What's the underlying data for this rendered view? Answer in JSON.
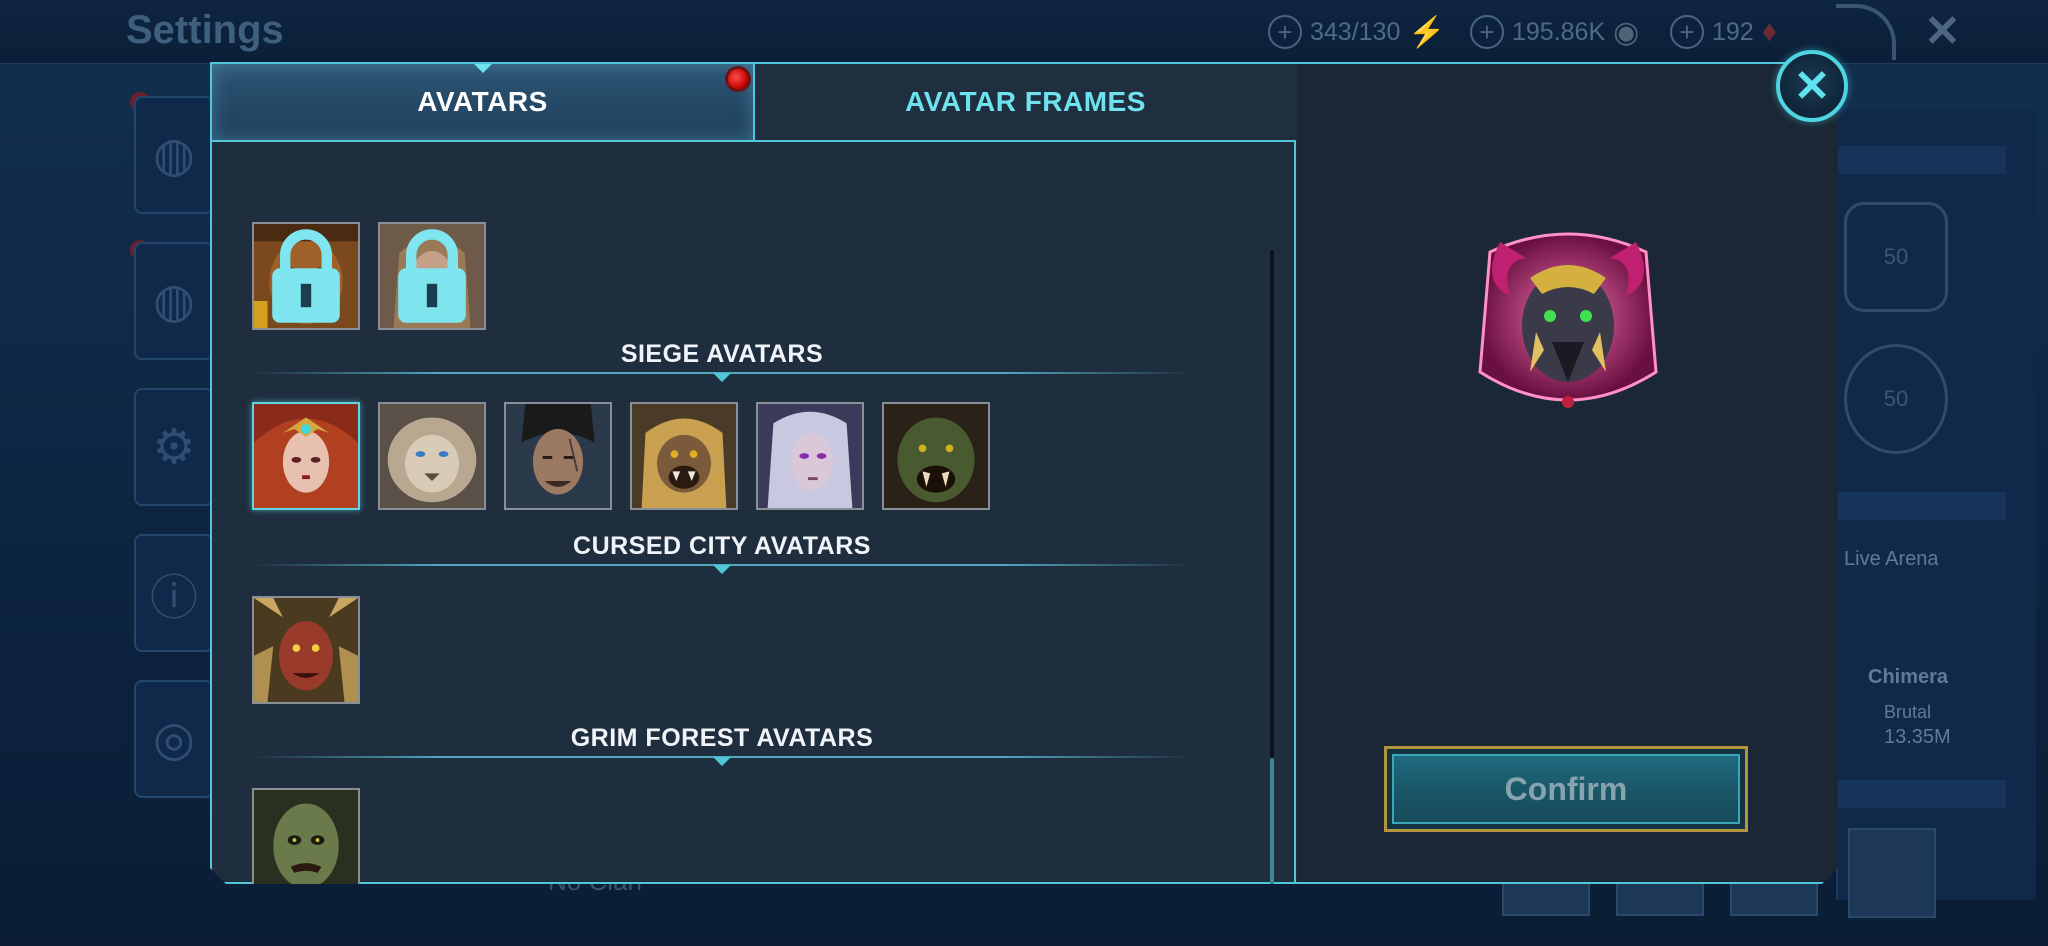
{
  "background": {
    "title": "Settings",
    "resources": [
      {
        "value": "343/130",
        "icon": "energy-icon"
      },
      {
        "value": "195.86K",
        "icon": "silver-coin-icon"
      },
      {
        "value": "192",
        "icon": "gem-icon"
      }
    ],
    "live_arena_label": "Live Arena",
    "chimera_label": "Chimera",
    "brutal_label": "Brutal",
    "damage_value": "13.35M",
    "clan_label": "No Clan",
    "badge_level": "50"
  },
  "modal": {
    "tabs": [
      {
        "label": "AVATARS",
        "active": true,
        "notification": true
      },
      {
        "label": "AVATAR FRAMES",
        "active": false,
        "notification": false
      }
    ],
    "sections": [
      {
        "title": "",
        "avatars": [
          {
            "name": "monkey-king-avatar",
            "locked": true
          },
          {
            "name": "blonde-woman-avatar",
            "locked": true
          }
        ]
      },
      {
        "title": "SIEGE AVATARS",
        "avatars": [
          {
            "name": "sorceress-avatar",
            "locked": false,
            "selected": true
          },
          {
            "name": "white-lion-avatar",
            "locked": false
          },
          {
            "name": "scarred-man-avatar",
            "locked": false
          },
          {
            "name": "golden-ape-avatar",
            "locked": false
          },
          {
            "name": "pale-elf-avatar",
            "locked": false
          },
          {
            "name": "orc-avatar",
            "locked": false
          }
        ]
      },
      {
        "title": "CURSED CITY AVATARS",
        "avatars": [
          {
            "name": "demon-avatar",
            "locked": false
          }
        ]
      },
      {
        "title": "GRIM FOREST AVATARS",
        "avatars": [
          {
            "name": "ghoul-avatar",
            "locked": false
          }
        ]
      }
    ],
    "preview_icon": "horned-beast-frame-icon",
    "confirm_label": "Confirm",
    "scroll_position": 0.95
  },
  "colors": {
    "accent": "#4fc7d8",
    "tab_inactive_text": "#6ee3ef",
    "notification": "#e01010",
    "confirm_border": "#b3943f"
  }
}
